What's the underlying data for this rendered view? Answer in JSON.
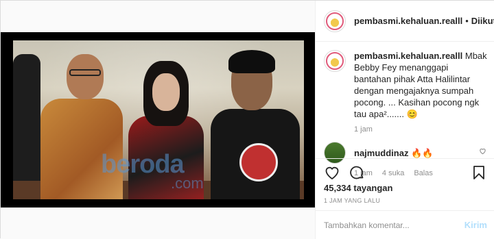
{
  "header": {
    "username": "pembasmi.kehaluan.realll",
    "separator": "•",
    "follow_label": "Diikuti"
  },
  "caption": {
    "username": "pembasmi.kehaluan.realll",
    "text": "Mbak Bebby Fey menanggapi bantahan pihak Atta Halilintar dengan mengajaknya sumpah pocong. ... Kasihan pocong ngk tau apa²....... 😊",
    "time": "1 jam"
  },
  "comments": [
    {
      "username": "najmuddinaz",
      "text": "🔥🔥",
      "time": "1 jam",
      "likes": "4 suka",
      "reply_label": "Balas"
    }
  ],
  "video": {
    "watermark_main": "beroda",
    "watermark_sub": ".com"
  },
  "stats": {
    "views": "45,334 tayangan",
    "posted": "1 JAM YANG LALU"
  },
  "add_comment": {
    "placeholder": "Tambahkan komentar...",
    "post_label": "Kirim"
  },
  "colors": {
    "accent_disabled": "#b2dffc",
    "meta_gray": "#8e8e8e",
    "border": "#efefef"
  },
  "icons": [
    "heart-icon",
    "comment-icon",
    "bookmark-icon",
    "small-heart-icon"
  ]
}
